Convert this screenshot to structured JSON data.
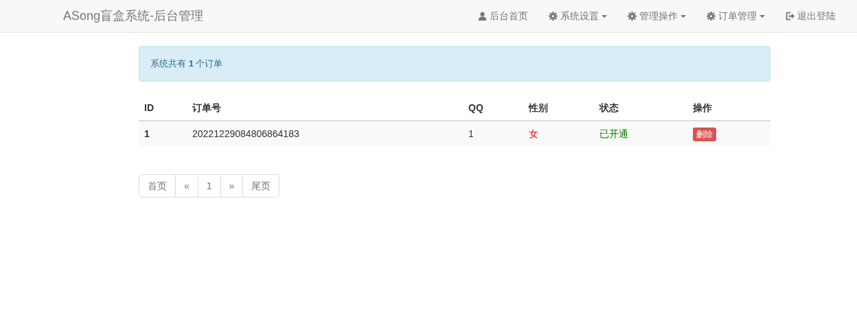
{
  "navbar": {
    "brand": "ASong盲盒系统-后台管理",
    "items": [
      {
        "label": "后台首页",
        "kind": "user",
        "dropdown": false
      },
      {
        "label": "系统设置",
        "kind": "gear",
        "dropdown": true
      },
      {
        "label": "管理操作",
        "kind": "gear",
        "dropdown": true
      },
      {
        "label": "订单管理",
        "kind": "gear",
        "dropdown": true
      },
      {
        "label": "退出登陆",
        "kind": "logout",
        "dropdown": false
      }
    ]
  },
  "alert": "系统共有 **1** 个订单",
  "table": {
    "columns": [
      "ID",
      "订单号",
      "QQ",
      "性别",
      "状态",
      "操作"
    ],
    "rows": [
      {
        "id": "1",
        "order_no": "20221229084806864183",
        "qq": "1",
        "gender": "女",
        "status": "已开通",
        "action": "删除"
      }
    ]
  },
  "pagination": [
    "首页",
    "«",
    "1",
    "»",
    "尾页"
  ]
}
